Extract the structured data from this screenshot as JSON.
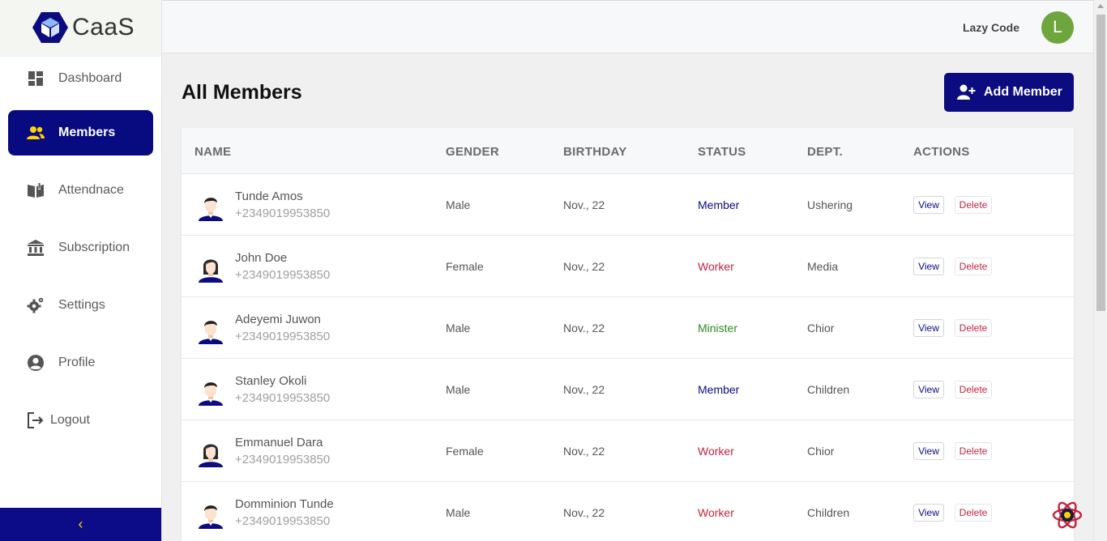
{
  "app": {
    "name": "CaaS",
    "accent": "#0c0c80",
    "accent_yellow": "#ffd200"
  },
  "sidebar": {
    "items": [
      {
        "label": "Dashboard",
        "icon": "dashboard-icon",
        "active": false
      },
      {
        "label": "Members",
        "icon": "users-icon",
        "active": true
      },
      {
        "label": "Attendnace",
        "icon": "book-icon",
        "active": false
      },
      {
        "label": "Subscription",
        "icon": "bank-icon",
        "active": false
      },
      {
        "label": "Settings",
        "icon": "gear-icon",
        "active": false
      },
      {
        "label": "Profile",
        "icon": "user-circle-icon",
        "active": false
      },
      {
        "label": "Logout",
        "icon": "logout-icon",
        "active": false
      }
    ],
    "collapse_glyph": "‹"
  },
  "header": {
    "username": "Lazy Code",
    "avatar_letter": "L",
    "avatar_color": "#6ea53c"
  },
  "main": {
    "title": "All Members",
    "add_button": "Add Member",
    "columns": [
      "NAME",
      "GENDER",
      "BIRTHDAY",
      "STATUS",
      "DEPT.",
      "ACTIONS"
    ],
    "rows": [
      {
        "name": "Tunde Amos",
        "phone": "+2349019953850",
        "gender": "Male",
        "birthday": "Nov., 22",
        "status": "Member",
        "dept": "Ushering",
        "view": "View",
        "delete": "Delete"
      },
      {
        "name": "John Doe",
        "phone": "+2349019953850",
        "gender": "Female",
        "birthday": "Nov., 22",
        "status": "Worker",
        "dept": "Media",
        "view": "View",
        "delete": "Delete"
      },
      {
        "name": "Adeyemi Juwon",
        "phone": "+2349019953850",
        "gender": "Male",
        "birthday": "Nov., 22",
        "status": "Minister",
        "dept": "Chior",
        "view": "View",
        "delete": "Delete"
      },
      {
        "name": "Stanley Okoli",
        "phone": "+2349019953850",
        "gender": "Male",
        "birthday": "Nov., 22",
        "status": "Member",
        "dept": "Children",
        "view": "View",
        "delete": "Delete"
      },
      {
        "name": "Emmanuel Dara",
        "phone": "+2349019953850",
        "gender": "Female",
        "birthday": "Nov., 22",
        "status": "Worker",
        "dept": "Chior",
        "view": "View",
        "delete": "Delete"
      },
      {
        "name": "Domminion Tunde",
        "phone": "+2349019953850",
        "gender": "Male",
        "birthday": "Nov., 22",
        "status": "Worker",
        "dept": "Children",
        "view": "View",
        "delete": "Delete"
      }
    ]
  },
  "status_colors": {
    "Member": "#0c0c80",
    "Worker": "#c0253f",
    "Minister": "#2a8a22"
  }
}
